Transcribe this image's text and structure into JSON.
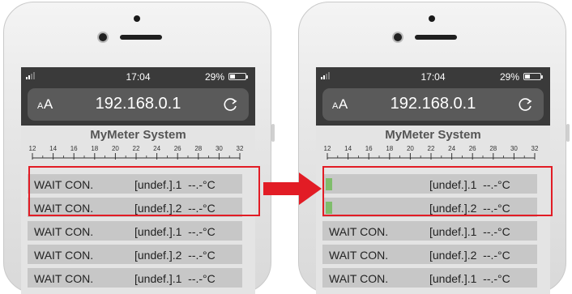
{
  "colors": {
    "accent_red": "#e21c25",
    "meter_bar": "#7fbd6b",
    "row_bg": "#c7c7c7",
    "page_bg": "#e4e4e4"
  },
  "left_phone": {
    "status": {
      "time": "17:04",
      "battery": "29%"
    },
    "browser": {
      "text_size_label": "AA",
      "url": "192.168.0.1",
      "reload_icon": "reload-icon"
    },
    "page_title": "MyMeter System",
    "scale_ticks": [
      "12",
      "14",
      "16",
      "18",
      "20",
      "22",
      "24",
      "26",
      "28",
      "30",
      "32"
    ],
    "rows": [
      {
        "name": "WAIT CON.",
        "value": "[undef.].1  --.-°C"
      },
      {
        "name": "WAIT CON.",
        "value": "[undef.].2  --.-°C"
      },
      {
        "name": "WAIT CON.",
        "value": "[undef.].1  --.-°C"
      },
      {
        "name": "WAIT CON.",
        "value": "[undef.].2  --.-°C"
      },
      {
        "name": "WAIT CON.",
        "value": "[undef.].1  --.-°C"
      }
    ]
  },
  "right_phone": {
    "status": {
      "time": "17:04",
      "battery": "29%"
    },
    "browser": {
      "text_size_label": "AA",
      "url": "192.168.0.1",
      "reload_icon": "reload-icon"
    },
    "page_title": "MyMeter System",
    "scale_ticks": [
      "12",
      "14",
      "16",
      "18",
      "20",
      "22",
      "24",
      "26",
      "28",
      "30",
      "32"
    ],
    "rows": [
      {
        "name": "",
        "value": "[undef.].1  --.-°C",
        "bar": true
      },
      {
        "name": "",
        "value": "[undef.].2  --.-°C",
        "bar": true
      },
      {
        "name": "WAIT CON.",
        "value": "[undef.].1  --.-°C"
      },
      {
        "name": "WAIT CON.",
        "value": "[undef.].2  --.-°C"
      },
      {
        "name": "WAIT CON.",
        "value": "[undef.].1  --.-°C"
      }
    ]
  }
}
